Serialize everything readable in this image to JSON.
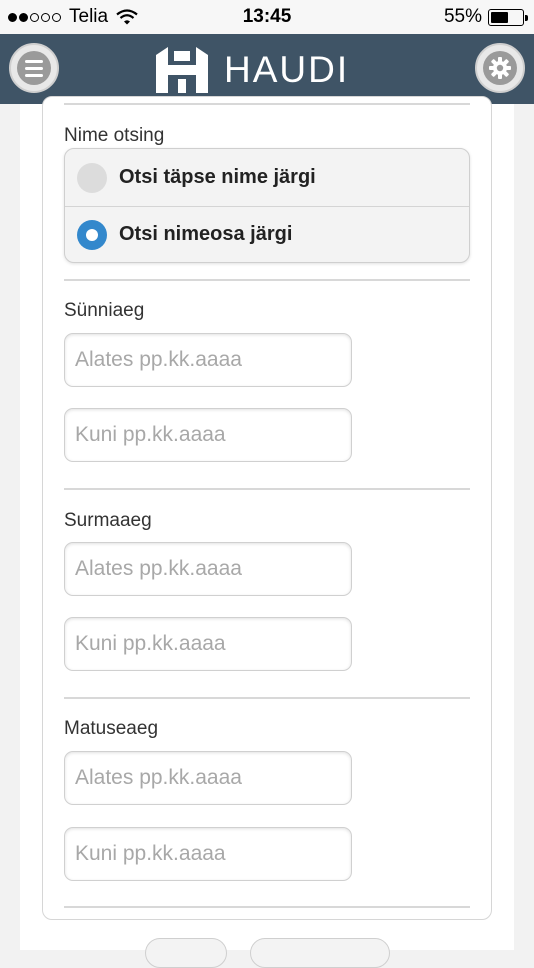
{
  "status_bar": {
    "carrier": "Telia",
    "time": "13:45",
    "battery_percent": "55%",
    "battery_level": 0.55,
    "signal_bars": 2,
    "signal_total": 5
  },
  "header": {
    "brand": "HAUDI",
    "menu_icon": "hamburger-menu-icon",
    "settings_icon": "gear-icon",
    "background_color": "#3f5466"
  },
  "name_search": {
    "label": "Nime otsing",
    "options": [
      {
        "label": "Otsi täpse nime järgi",
        "selected": false
      },
      {
        "label": "Otsi nimeosa järgi",
        "selected": true
      }
    ],
    "accent_color": "#3388cc"
  },
  "birth_date": {
    "label": "Sünniaeg",
    "from_placeholder": "Alates pp.kk.aaaa",
    "to_placeholder": "Kuni pp.kk.aaaa"
  },
  "death_date": {
    "label": "Surmaaeg",
    "from_placeholder": "Alates pp.kk.aaaa",
    "to_placeholder": "Kuni pp.kk.aaaa"
  },
  "burial_date": {
    "label": "Matuseaeg",
    "from_placeholder": "Alates pp.kk.aaaa",
    "to_placeholder": "Kuni pp.kk.aaaa"
  }
}
